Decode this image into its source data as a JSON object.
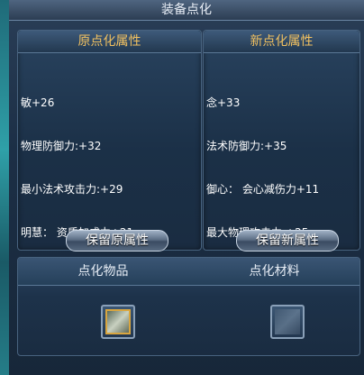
{
  "window": {
    "title": "装备点化"
  },
  "left_panel": {
    "header": "原点化属性",
    "attrs": [
      "敏+26",
      "物理防御力:+32",
      "最小法术攻击力:+29",
      "明慧： 资质加成力+21"
    ],
    "button": "保留原属性"
  },
  "right_panel": {
    "header": "新点化属性",
    "attrs": [
      "念+33",
      "法术防御力:+35",
      "御心： 会心减伤力+11",
      "最大物理攻击力:+25"
    ],
    "button": "保留新属性"
  },
  "bottom": {
    "item_label": "点化物品",
    "material_label": "点化材料",
    "item_icon": "equipment-icon",
    "material_icon": "material-icon"
  },
  "colors": {
    "header_gold": "#f0c060",
    "text_white": "#ffffff",
    "frame_blue": "#1c2f46"
  }
}
